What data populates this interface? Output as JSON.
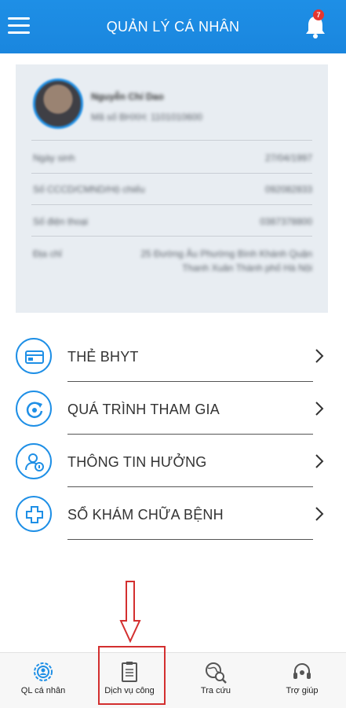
{
  "header": {
    "title": "QUẢN LÝ CÁ NHÂN",
    "notification_count": "7",
    "menu_icon": "hamburger-icon",
    "bell_icon": "bell-icon"
  },
  "profile": {
    "name": "Nguyễn Chí Dao",
    "id_line": "Mã số BHXH: 1101010600",
    "rows": [
      {
        "label": "Ngày sinh",
        "value": "27/04/1997"
      },
      {
        "label": "Số CCCD/CMND/Hộ chiếu",
        "value": "092082833"
      },
      {
        "label": "Số điện thoại",
        "value": "0387378800"
      }
    ],
    "address_label": "Địa chỉ",
    "address_value": "25 Đường Âu Phường Bình Khánh Quận Thanh Xuân Thành phố Hà Nội"
  },
  "menu": [
    {
      "label": "THẺ BHYT",
      "icon": "health-card-icon"
    },
    {
      "label": "QUÁ TRÌNH THAM GIA",
      "icon": "refresh-process-icon"
    },
    {
      "label": "THÔNG TIN HƯỞNG",
      "icon": "user-info-icon"
    },
    {
      "label": "SỔ KHÁM CHỮA BỆNH",
      "icon": "medical-cross-icon"
    }
  ],
  "bottom_nav": [
    {
      "label": "QL cá nhân",
      "icon": "user-settings-icon"
    },
    {
      "label": "Dịch vụ công",
      "icon": "document-icon"
    },
    {
      "label": "Tra cứu",
      "icon": "globe-search-icon"
    },
    {
      "label": "Trợ giúp",
      "icon": "headset-icon"
    }
  ],
  "colors": {
    "primary": "#1e8fe6",
    "annotation": "#d32f2f",
    "badge": "#e6362f"
  }
}
